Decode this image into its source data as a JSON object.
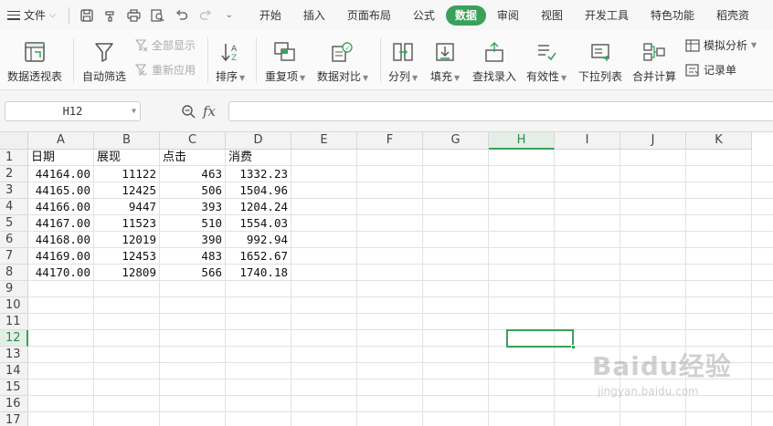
{
  "menu": {
    "file_label": "文件",
    "tabs": [
      "开始",
      "插入",
      "页面布局",
      "公式",
      "数据",
      "审阅",
      "视图",
      "开发工具",
      "特色功能",
      "稻壳资"
    ],
    "active_tab": "数据"
  },
  "ribbon": {
    "pivot": "数据透视表",
    "autofilter": "自动筛选",
    "show_all": "全部显示",
    "reapply": "重新应用",
    "sort": "排序",
    "duplicates": "重复项",
    "compare": "数据对比",
    "split": "分列",
    "fill": "填充",
    "lookup": "查找录入",
    "validity": "有效性",
    "dropdown": "下拉列表",
    "consolidate": "合并计算",
    "whatif": "模拟分析",
    "record": "记录单"
  },
  "formula_bar": {
    "name_box": "H12",
    "fx_label": "fx",
    "content": ""
  },
  "sheet": {
    "columns": [
      "A",
      "B",
      "C",
      "D",
      "E",
      "F",
      "G",
      "H",
      "I",
      "J",
      "K"
    ],
    "selected_column": "H",
    "rows": [
      "1",
      "2",
      "3",
      "4",
      "5",
      "6",
      "7",
      "8",
      "9",
      "10",
      "11",
      "12",
      "13",
      "14",
      "15",
      "16",
      "17"
    ],
    "selected_row": "12",
    "headers": [
      "日期",
      "展现",
      "点击",
      "消费"
    ],
    "data": [
      [
        "44164.00",
        "11122",
        "463",
        "1332.23"
      ],
      [
        "44165.00",
        "12425",
        "506",
        "1504.96"
      ],
      [
        "44166.00",
        "9447",
        "393",
        "1204.24"
      ],
      [
        "44167.00",
        "11523",
        "510",
        "1554.03"
      ],
      [
        "44168.00",
        "12019",
        "390",
        "992.94"
      ],
      [
        "44169.00",
        "12453",
        "483",
        "1652.67"
      ],
      [
        "44170.00",
        "12809",
        "566",
        "1740.18"
      ]
    ]
  },
  "watermark": {
    "brand": "Baidu经验",
    "url": "jingyan.baidu.com"
  },
  "colors": {
    "accent": "#39a15a"
  }
}
